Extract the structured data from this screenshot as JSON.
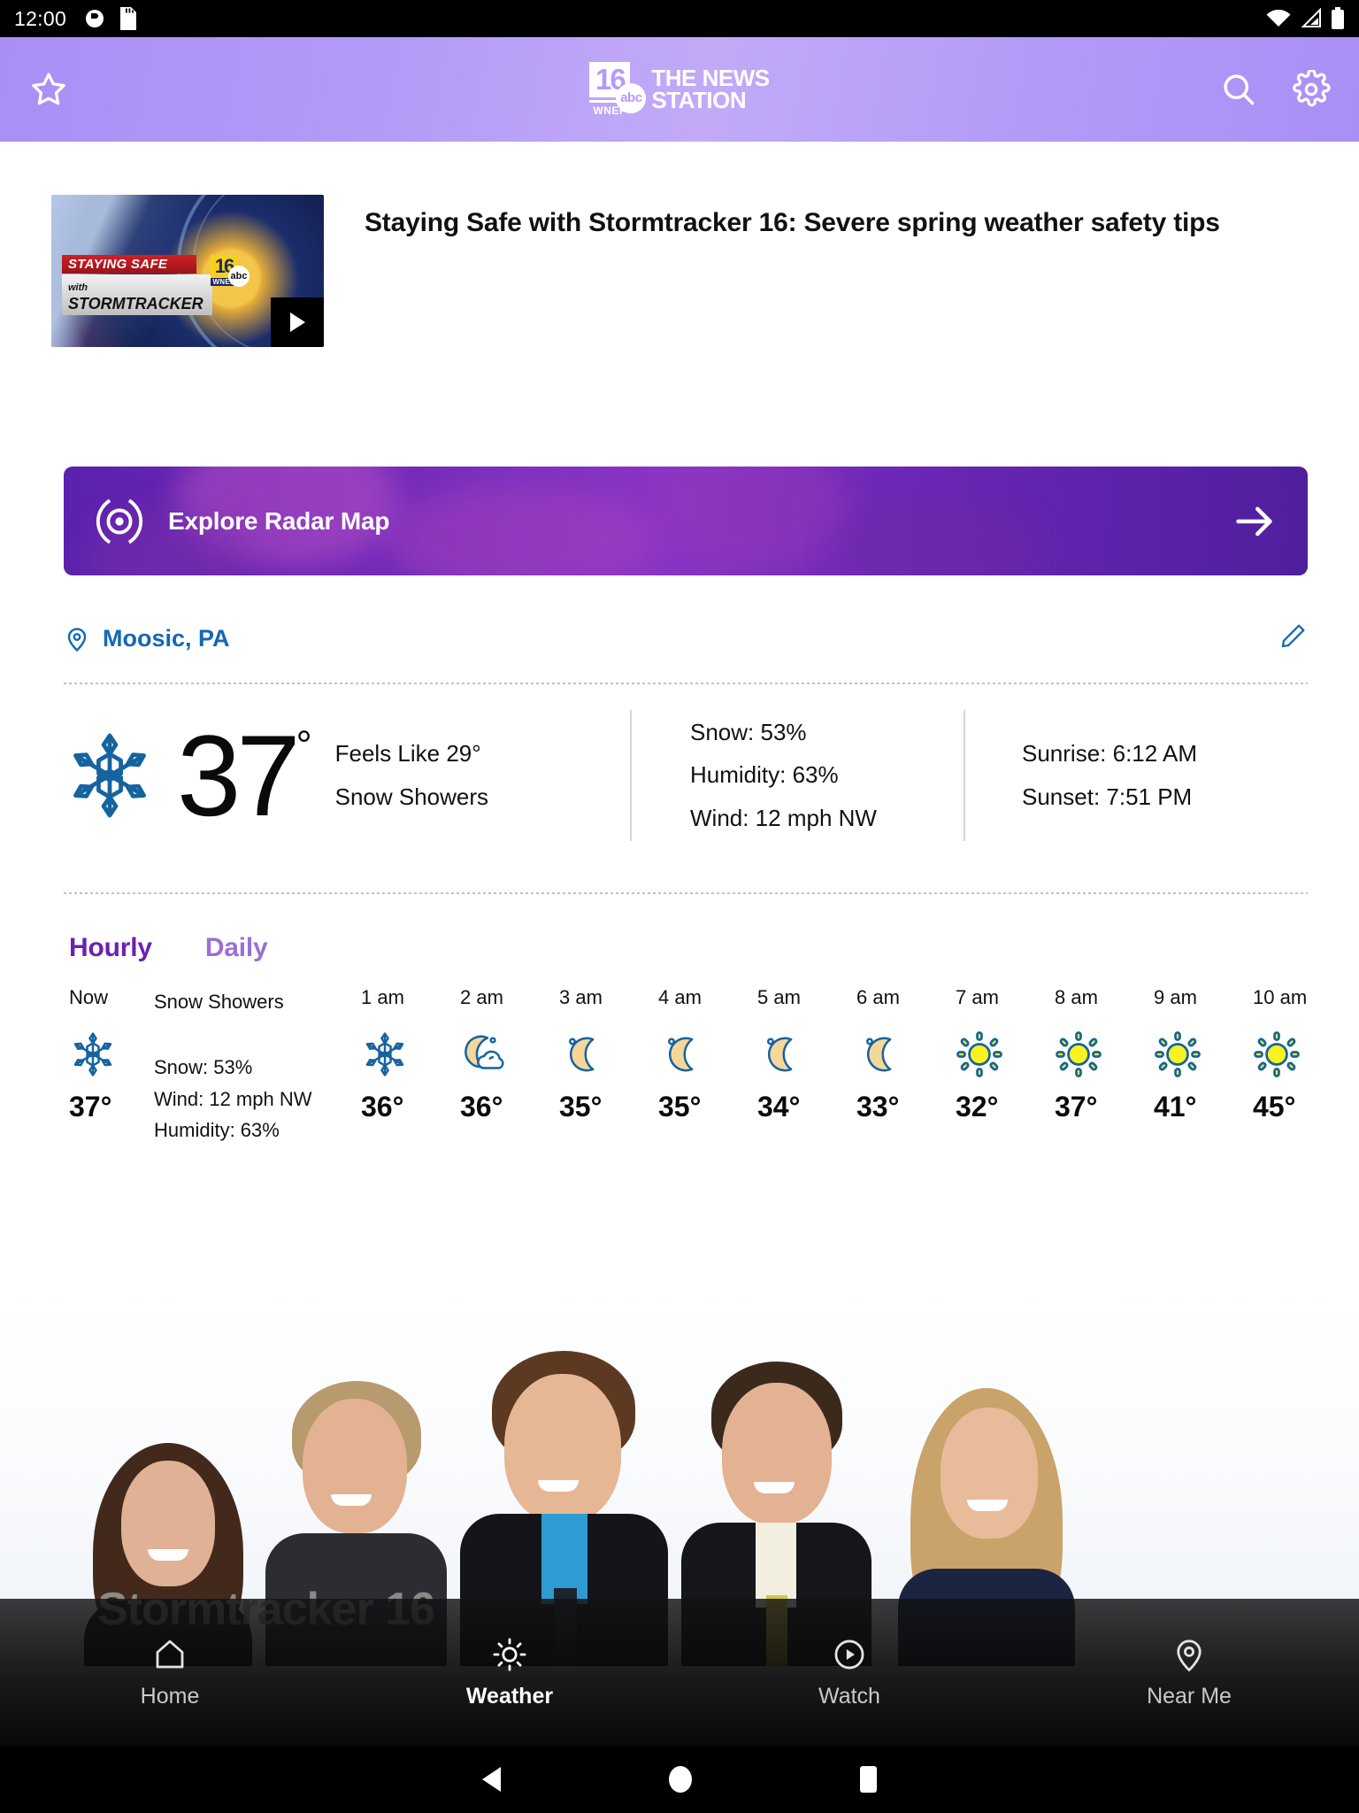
{
  "statusbar": {
    "time": "12:00",
    "icons": [
      "notification-icon",
      "sd-card-icon",
      "wifi-icon",
      "cell-signal-icon",
      "battery-icon"
    ]
  },
  "appbar": {
    "favorite_icon": "star-icon",
    "search_icon": "search-icon",
    "settings_icon": "gear-icon",
    "logo": {
      "channel": "16",
      "call_sign": "WNEP",
      "network": "abc",
      "line1": "THE NEWS",
      "line2": "STATION"
    }
  },
  "article": {
    "title": "Staying Safe with Stormtracker 16: Severe spring weather safety tips",
    "thumbnail": {
      "banner_line1": "STAYING SAFE",
      "banner_prefix": "with",
      "banner_line2": "STORMTRACKER",
      "badge_channel": "16",
      "badge_network": "abc",
      "badge_callsign": "WNEP"
    },
    "play_icon": "play-icon"
  },
  "radar_banner": {
    "label": "Explore Radar Map",
    "icon": "radar-target-icon",
    "arrow_icon": "arrow-right-icon"
  },
  "location": {
    "name": "Moosic, PA",
    "pin_icon": "location-pin-icon",
    "edit_icon": "pencil-edit-icon",
    "color": "#1368b7"
  },
  "current": {
    "icon": "snowflake-icon",
    "temperature": "37",
    "degree": "°",
    "feels_like": "Feels Like 29°",
    "condition": "Snow Showers",
    "stats": [
      "Snow: 53%",
      "Humidity: 63%",
      "Wind: 12 mph NW"
    ],
    "sun": [
      "Sunrise: 6:12 AM",
      "Sunset: 7:51 PM"
    ]
  },
  "forecast_tabs": {
    "hourly": "Hourly",
    "daily": "Daily",
    "active": "Hourly",
    "active_color": "#6b21b0",
    "inactive_color": "#9b6fd4"
  },
  "hourly": {
    "now": {
      "label": "Now",
      "icon": "snowflake-icon",
      "temp": "37°",
      "condition": "Snow Showers",
      "details": [
        "Snow: 53%",
        "Wind: 12 mph NW",
        "Humidity: 63%"
      ]
    },
    "hours": [
      {
        "label": "1 am",
        "icon": "snowflake-icon",
        "temp": "36°"
      },
      {
        "label": "2 am",
        "icon": "moon-cloud-icon",
        "temp": "36°"
      },
      {
        "label": "3 am",
        "icon": "crescent-moon-icon",
        "temp": "35°"
      },
      {
        "label": "4 am",
        "icon": "crescent-moon-icon",
        "temp": "35°"
      },
      {
        "label": "5 am",
        "icon": "crescent-moon-icon",
        "temp": "34°"
      },
      {
        "label": "6 am",
        "icon": "crescent-moon-icon",
        "temp": "33°"
      },
      {
        "label": "7 am",
        "icon": "sun-icon",
        "temp": "32°"
      },
      {
        "label": "8 am",
        "icon": "sun-icon",
        "temp": "37°"
      },
      {
        "label": "9 am",
        "icon": "sun-icon",
        "temp": "41°"
      },
      {
        "label": "10 am",
        "icon": "sun-icon",
        "temp": "45°"
      }
    ]
  },
  "team_photo": {
    "watermark": "Stormtracker 16"
  },
  "bottomnav": {
    "items": [
      {
        "label": "Home",
        "icon": "home-icon",
        "active": false
      },
      {
        "label": "Weather",
        "icon": "sun-icon",
        "active": true
      },
      {
        "label": "Watch",
        "icon": "play-circle-icon",
        "active": false
      },
      {
        "label": "Near Me",
        "icon": "map-pin-icon",
        "active": false
      }
    ]
  },
  "androidnav": {
    "back": "back-icon",
    "home": "home-circle-icon",
    "recents": "recents-icon"
  }
}
